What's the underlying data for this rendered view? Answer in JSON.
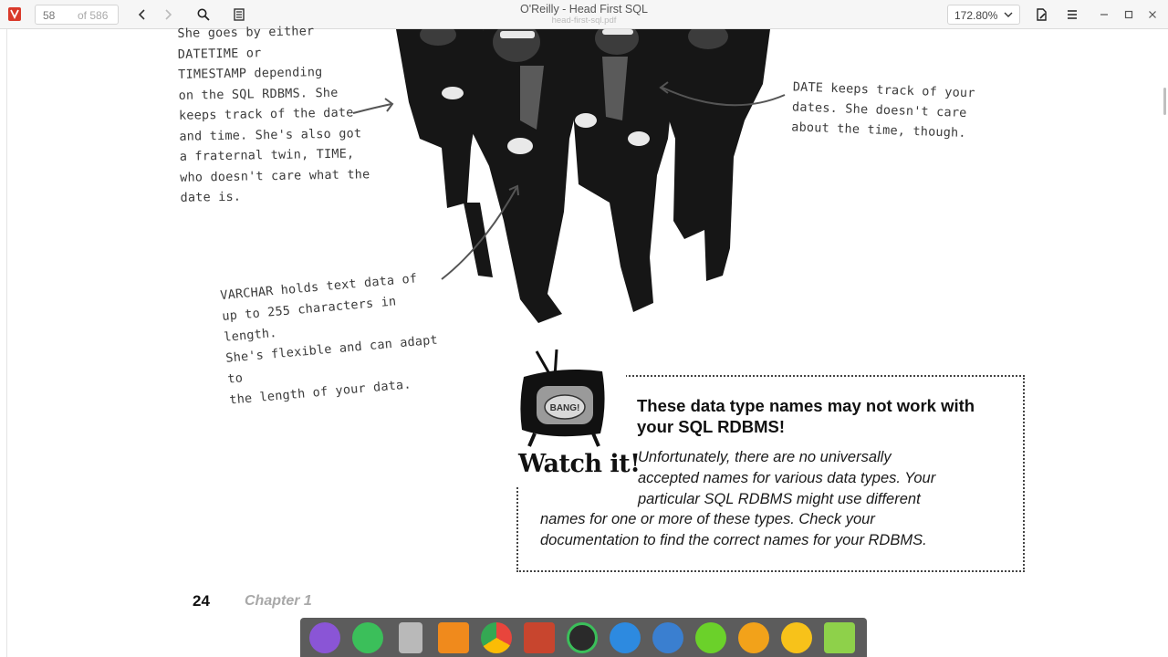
{
  "toolbar": {
    "current_page": "58",
    "total_pages": "of 586",
    "window_title": "O'Reilly - Head First SQL",
    "file_name": "head-first-sql.pdf",
    "zoom_level": "172.80%",
    "icons": [
      "app-icon",
      "prev-page-icon",
      "next-page-icon",
      "search-icon",
      "sidebar-toggle-icon",
      "zoom-chevron-icon",
      "annotate-icon",
      "menu-icon",
      "minimize-icon",
      "maximize-icon",
      "close-icon"
    ]
  },
  "document": {
    "caption_left": [
      "She goes by either",
      "DATETIME or",
      "TIMESTAMP depending",
      "on the SQL RDBMS. She",
      "keeps track of the date",
      "and time. She's also got",
      "a fraternal twin, TIME,",
      "who doesn't care what the",
      "date is."
    ],
    "caption_right": [
      "DATE keeps track of your",
      "dates. She doesn't care",
      "about the time, though."
    ],
    "caption_bottom": [
      "VARCHAR holds text data of",
      "up to 255 characters in length.",
      "She's flexible and can adapt to",
      "the length of your data."
    ],
    "tv_bubble": "BANG!",
    "watch_label": "Watch it!",
    "warning_heading": "These data type names may not work with your SQL RDBMS!",
    "warning_body": [
      "Unfortunately, there are no universally",
      "accepted names for various data types. Your",
      "particular SQL RDBMS might use different",
      "names for one or more of these types. Check your",
      "documentation to find the correct names for your RDBMS."
    ],
    "page_number": "24",
    "chapter": "Chapter 1"
  },
  "dock": {
    "items": [
      "launcher-icon",
      "store-icon",
      "file-manager-icon",
      "app-store-icon",
      "chrome-icon",
      "pdf-reader-icon",
      "screenshot-icon",
      "wifi-icon",
      "recorder-icon",
      "power-icon",
      "headset-icon",
      "clock-icon",
      "trash-icon"
    ],
    "colors": [
      "#8a55d6",
      "#3bbf5a",
      "#b9b9b9",
      "#f08a1c",
      "#e7e7e7",
      "#c8452e",
      "#2a2a2a",
      "#2d8ae0",
      "#3a7fd0",
      "#6bd12a",
      "#f2a21a",
      "#f7c21a",
      "#8ed14a"
    ]
  }
}
